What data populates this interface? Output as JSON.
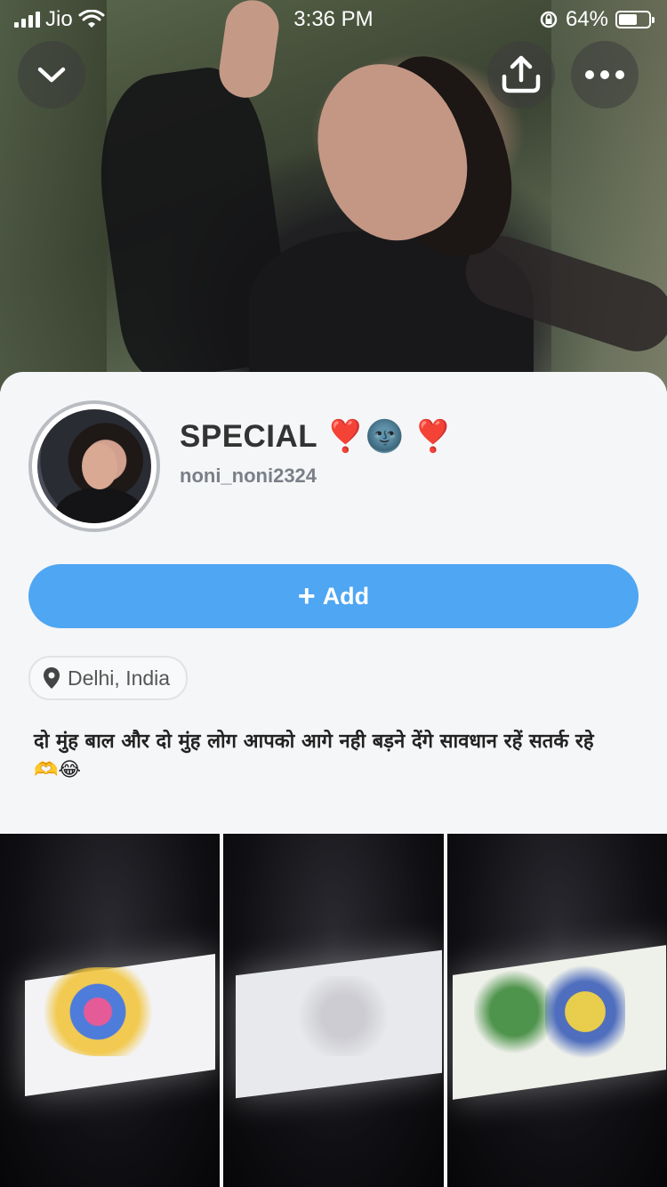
{
  "status_bar": {
    "carrier": "Jio",
    "time": "3:36 PM",
    "battery_percent": "64%",
    "battery_level": 0.64
  },
  "header": {
    "collapse_icon": "chevron-down-icon",
    "share_icon": "share-upload-icon",
    "more_icon": "more-dots-icon"
  },
  "profile": {
    "display_name": "SPECIAL ❣️🌚 ❣️",
    "username": "noni_noni2324",
    "add_label": "Add",
    "add_prefix": "+",
    "location": "Delhi, India",
    "bio": "दो मुंह बाल और दो मुंह लोग आपको आगे नही बड़ने देंगे सावधान रहें सतर्क रहे🫶😂"
  },
  "colors": {
    "accent": "#4fa6f2",
    "card_bg": "#f5f6f8",
    "text_primary": "#333333",
    "text_secondary": "#7a7f88"
  }
}
